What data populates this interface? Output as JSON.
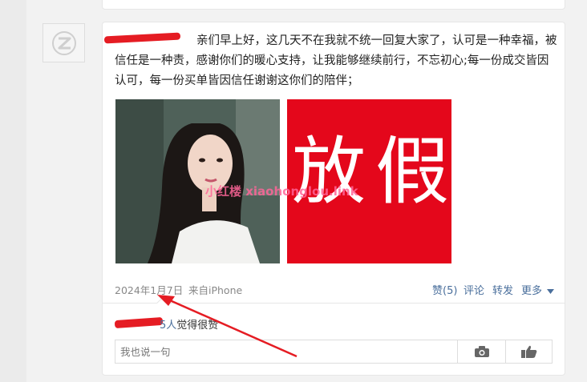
{
  "post": {
    "author": "",
    "text": "亲们早上好，这几天不在我就不统一回复大家了，认可是一种幸福，被信任是一种责，感谢你们的暖心支持，让我能够继续前行，不忘初心;每一份成交皆因认可，每一份买单皆因信任谢谢这你们的陪伴；",
    "image_right_text": [
      "放",
      "假"
    ],
    "watermark": "小红楼 xiaohonglou.link",
    "date": "2024年1月7日",
    "source": "来自iPhone"
  },
  "actions": {
    "like": "赞(5)",
    "comment": "评论",
    "share": "转发",
    "more": "更多"
  },
  "likes": {
    "count": "5人",
    "suffix": "觉得很赞"
  },
  "comment": {
    "placeholder": "我也说一句"
  },
  "icons": {
    "avatar": "default-avatar-icon",
    "camera": "camera-icon",
    "like": "thumbs-up-icon",
    "dropdown": "triangle-down-icon"
  },
  "colors": {
    "link": "#4a6f9c",
    "annotation_red": "#e51c23",
    "image_red": "#e4071b"
  }
}
